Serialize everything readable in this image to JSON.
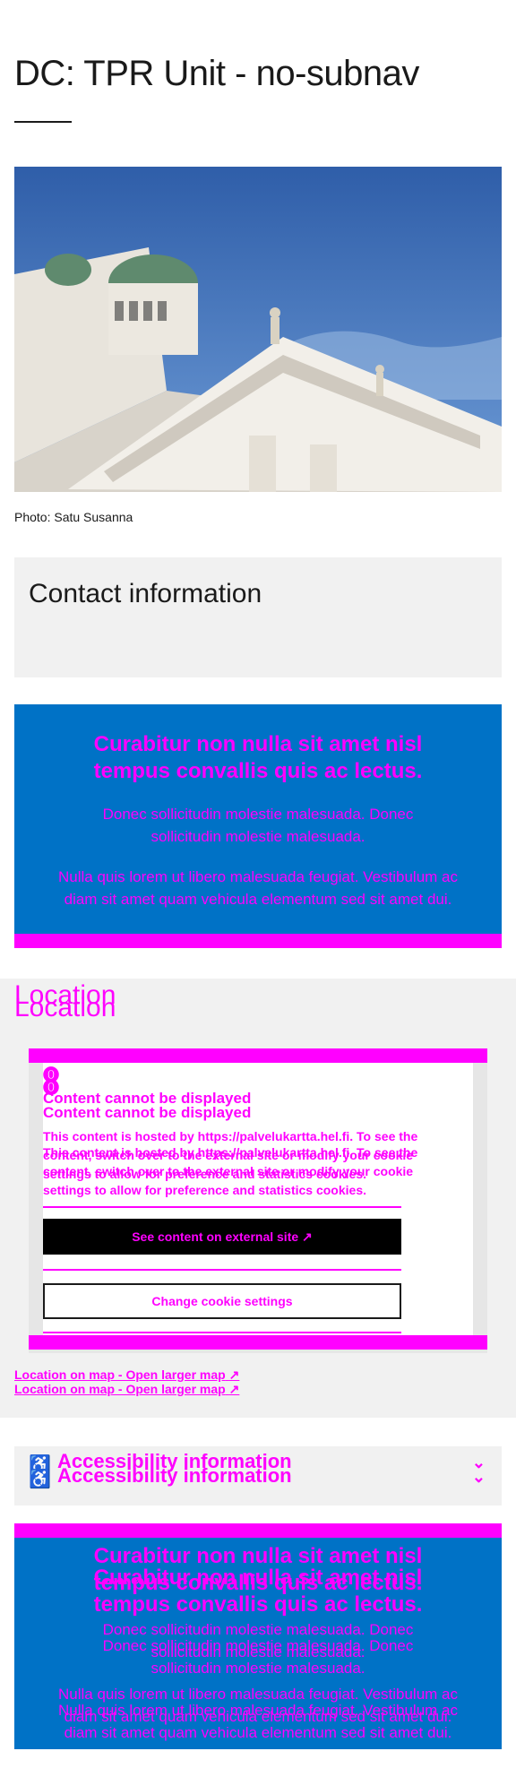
{
  "page": {
    "title": "DC: TPR Unit - no-subnav"
  },
  "hero": {
    "caption": "Photo: Satu Susanna"
  },
  "contact": {
    "heading": "Contact information"
  },
  "banner": {
    "title": "Curabitur non nulla sit amet nisl tempus convallis quis ac lectus.",
    "text1": "Donec sollicitudin molestie malesuada. Donec sollicitudin molestie malesuada.",
    "text2": "Nulla quis lorem ut libero malesuada feugiat. Vestibulum ac diam sit amet quam vehicula elementum sed sit amet dui."
  },
  "location": {
    "heading": "Location",
    "embed": {
      "title": "Content cannot be displayed",
      "text": "This content is hosted by https://palvelukartta.hel.fi. To see the content, switch over to the external site or modify your cookie settings to allow for preference and statistics cookies.",
      "primary_button": "See content on external site",
      "secondary_button": "Change cookie settings"
    },
    "map_link": "Location on map - Open larger map"
  },
  "accessibility": {
    "label": "Accessibility information"
  },
  "colors": {
    "banner": "#0072c6",
    "accent": "#ff00ff",
    "panel": "#f1f1f1"
  },
  "icons": [
    "alert-icon",
    "external-link-icon",
    "accessibility-icon",
    "chevron-down-icon"
  ]
}
